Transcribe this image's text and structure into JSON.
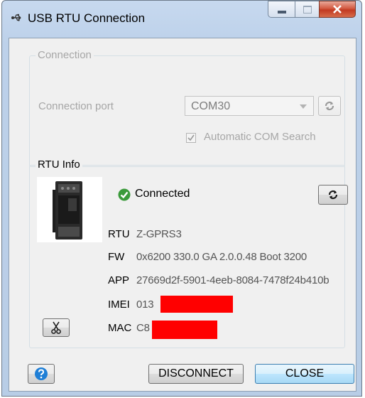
{
  "window": {
    "title": "USB RTU Connection",
    "icon": "usb-icon"
  },
  "connection_group": {
    "legend": "Connection",
    "port_label": "Connection port",
    "port_value": "COM30",
    "auto_search_label": "Automatic COM Search",
    "auto_search_checked": true,
    "enabled": false
  },
  "rtu_group": {
    "legend": "RTU Info",
    "status_text": "Connected",
    "status_icon": "check-circle-icon",
    "rows": [
      {
        "label": "RTU",
        "value": "Z-GPRS3"
      },
      {
        "label": "FW",
        "value": "0x6200 330.0 GA 2.0.0.48 Boot 3200"
      },
      {
        "label": "APP",
        "value": "27669d2f-5901-4eeb-8084-7478f24b410b"
      },
      {
        "label": "IMEI",
        "value": "013"
      },
      {
        "label": "MAC",
        "value": "C8"
      }
    ],
    "redaction_color": "#ff0000"
  },
  "footer": {
    "disconnect_label": "DISCONNECT",
    "close_label": "CLOSE"
  },
  "colors": {
    "accent_blue": "#1f7fd6",
    "status_green": "#3a9a3a"
  }
}
